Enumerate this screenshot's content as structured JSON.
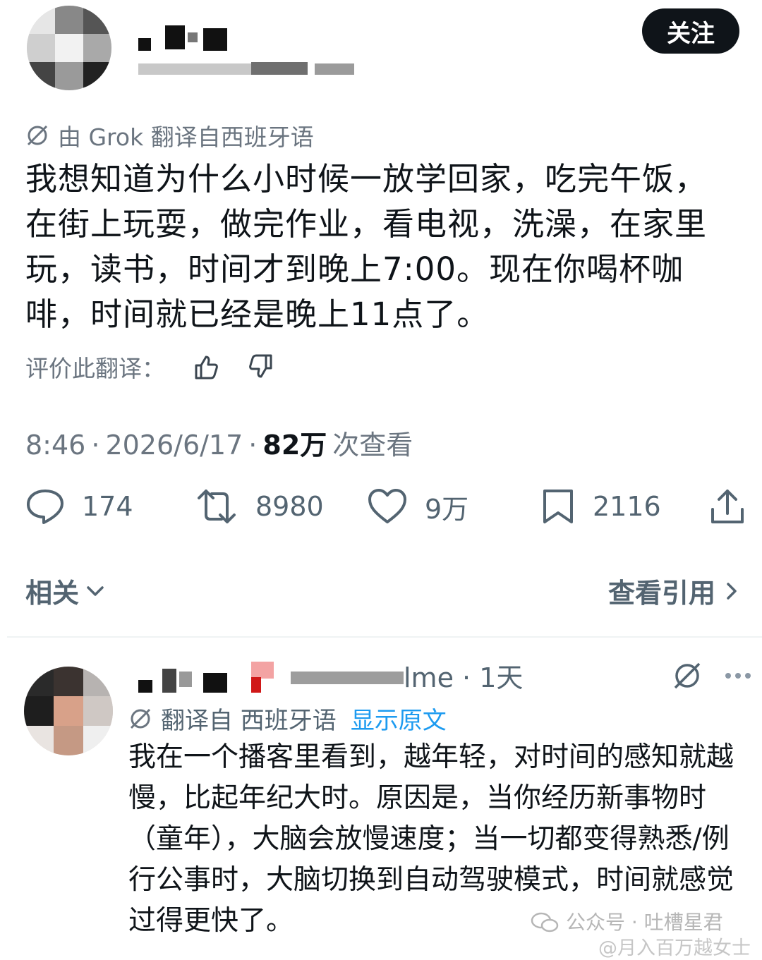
{
  "header": {
    "follow_label": "关注"
  },
  "post": {
    "translated_label": "由 Grok 翻译自西班牙语",
    "text": "我想知道为什么小时候一放学回家，吃完午饭，在街上玩耍，做完作业，看电视，洗澡，在家里玩，读书，时间才到晚上7:00。现在你喝杯咖啡，时间就已经是晚上11点了。",
    "rate_label": "评价此翻译：",
    "time": "8:46",
    "date": "2026/6/17",
    "views_count": "82万",
    "views_label": "次查看"
  },
  "actions": {
    "replies": "174",
    "reposts": "8980",
    "likes": "9万",
    "bookmarks": "2116"
  },
  "related_label": "相关",
  "quotes_label": "查看引用",
  "reply": {
    "handle_suffix": "lme",
    "age": "1天",
    "translated_label": "翻译自 西班牙语",
    "show_original": "显示原文",
    "text": "我在一个播客里看到，越年轻，对时间的感知就越慢，比起年纪大时。原因是，当你经历新事物时（童年），大脑会放慢速度；当一切都变得熟悉/例行公事时，大脑切换到自动驾驶模式，时间就感觉过得更快了。"
  },
  "watermark": {
    "line1": "公众号 · 吐槽星君",
    "line2": "@月入百万越女士"
  },
  "colors": {
    "text": "#0f1419",
    "muted": "#536471",
    "link": "#1d9bf0"
  }
}
